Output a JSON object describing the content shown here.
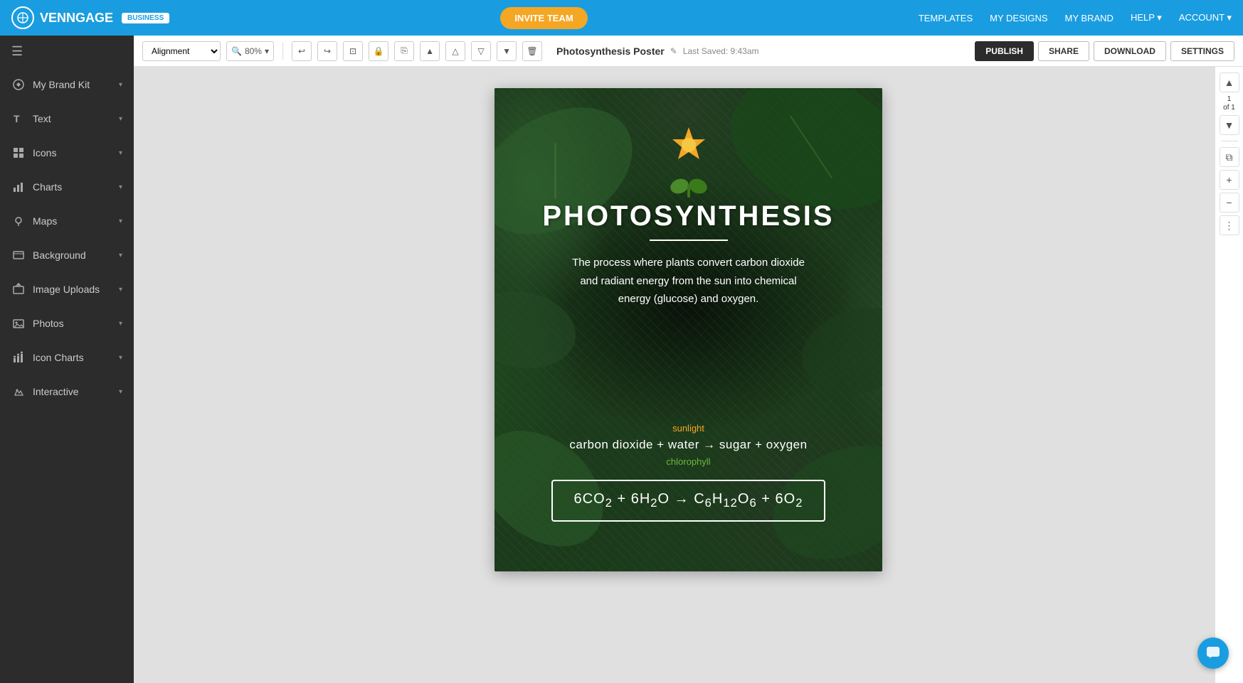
{
  "topnav": {
    "logo_text": "VENNGAGE",
    "badge": "BUSINESS",
    "invite_btn": "INVITE TEAM",
    "links": [
      "TEMPLATES",
      "MY DESIGNS",
      "MY BRAND",
      "HELP ▾",
      "ACCOUNT ▾"
    ]
  },
  "sidebar": {
    "items": [
      {
        "id": "my-brand-kit",
        "label": "My Brand Kit",
        "icon": "brand"
      },
      {
        "id": "text",
        "label": "Text",
        "icon": "text"
      },
      {
        "id": "icons",
        "label": "Icons",
        "icon": "icons"
      },
      {
        "id": "charts",
        "label": "Charts",
        "icon": "charts"
      },
      {
        "id": "maps",
        "label": "Maps",
        "icon": "maps"
      },
      {
        "id": "background",
        "label": "Background",
        "icon": "background"
      },
      {
        "id": "image-uploads",
        "label": "Image Uploads",
        "icon": "image-uploads"
      },
      {
        "id": "photos",
        "label": "Photos",
        "icon": "photos"
      },
      {
        "id": "icon-charts",
        "label": "Icon Charts",
        "icon": "icon-charts"
      },
      {
        "id": "interactive",
        "label": "Interactive",
        "icon": "interactive"
      }
    ]
  },
  "toolbar": {
    "alignment_label": "Alignment",
    "zoom_value": "80%",
    "doc_title": "Photosynthesis Poster",
    "last_saved": "Last Saved: 9:43am",
    "publish_btn": "PUBLISH",
    "share_btn": "SHARE",
    "download_btn": "DOWNLOAD",
    "settings_btn": "SETTINGS"
  },
  "right_panel": {
    "page_current": "1",
    "page_label": "of 1"
  },
  "poster": {
    "title": "PHOTOSYNTHESIS",
    "description": "The process where plants convert carbon dioxide and radiant energy from the sun into chemical energy (glucose) and oxygen.",
    "sunlight_label": "sunlight",
    "equation_main": "carbon dioxide + water → sugar + oxygen",
    "chlorophyll_label": "chlorophyll",
    "formula": "6CO₂ + 6H₂O → C₆H₁₂O₆ + 6O₂"
  }
}
